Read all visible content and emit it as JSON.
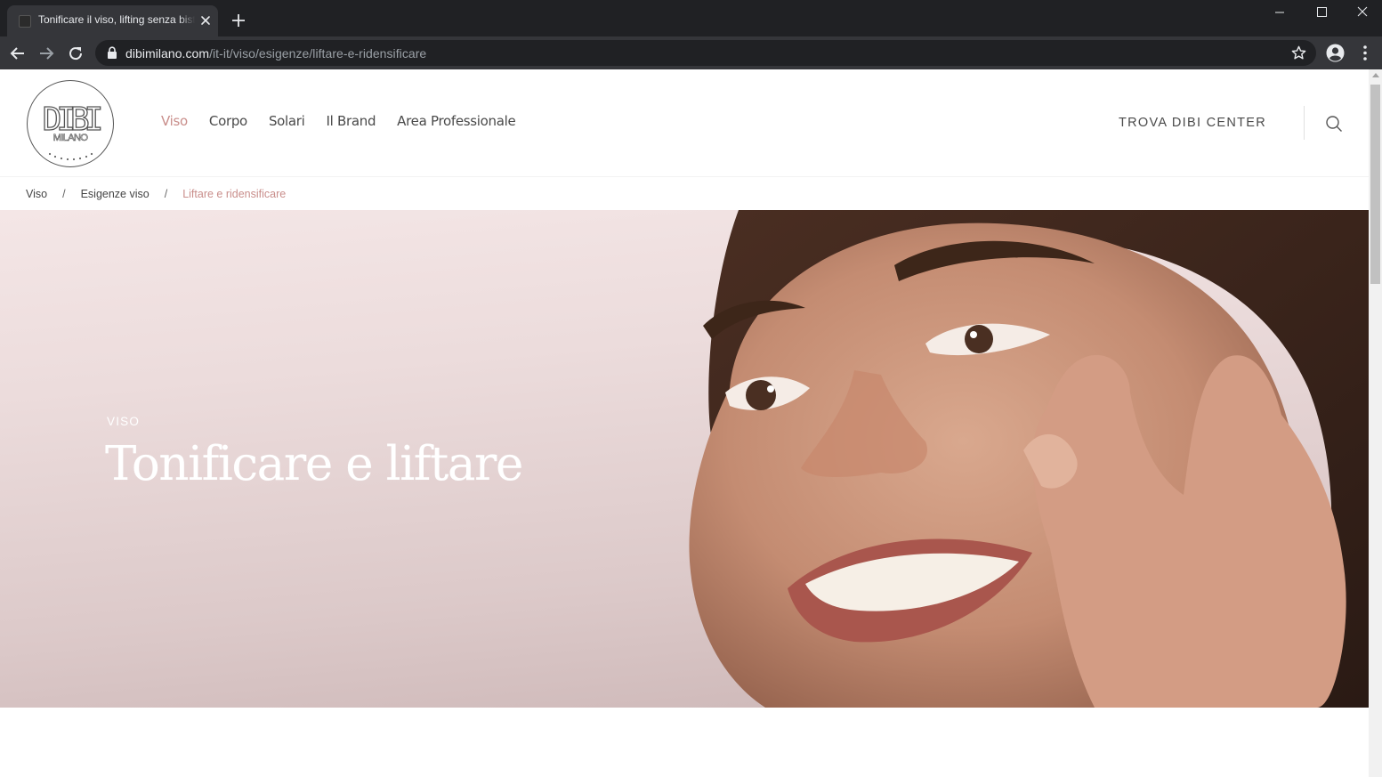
{
  "browser": {
    "tab_title": "Tonificare il viso, lifting senza bisturi",
    "url_domain": "dibimilano.com",
    "url_path": "/it-it/viso/esigenze/liftare-e-ridensificare"
  },
  "header": {
    "logo_text": "DIBI",
    "logo_subtext": "MILANO",
    "nav": [
      {
        "label": "Viso",
        "active": true
      },
      {
        "label": "Corpo",
        "active": false
      },
      {
        "label": "Solari",
        "active": false
      },
      {
        "label": "Il Brand",
        "active": false
      },
      {
        "label": "Area Professionale",
        "active": false
      }
    ],
    "cta": "TROVA DIBI CENTER"
  },
  "breadcrumb": {
    "items": [
      "Viso",
      "Esigenze viso"
    ],
    "separator": "/",
    "current": "Liftare e ridensificare"
  },
  "hero": {
    "overline": "VISO",
    "title": "Tonificare e liftare"
  },
  "colors": {
    "accent": "#c98e8b",
    "chrome_dark": "#202124",
    "chrome_tab": "#35363a",
    "text": "#4a4a4a"
  }
}
